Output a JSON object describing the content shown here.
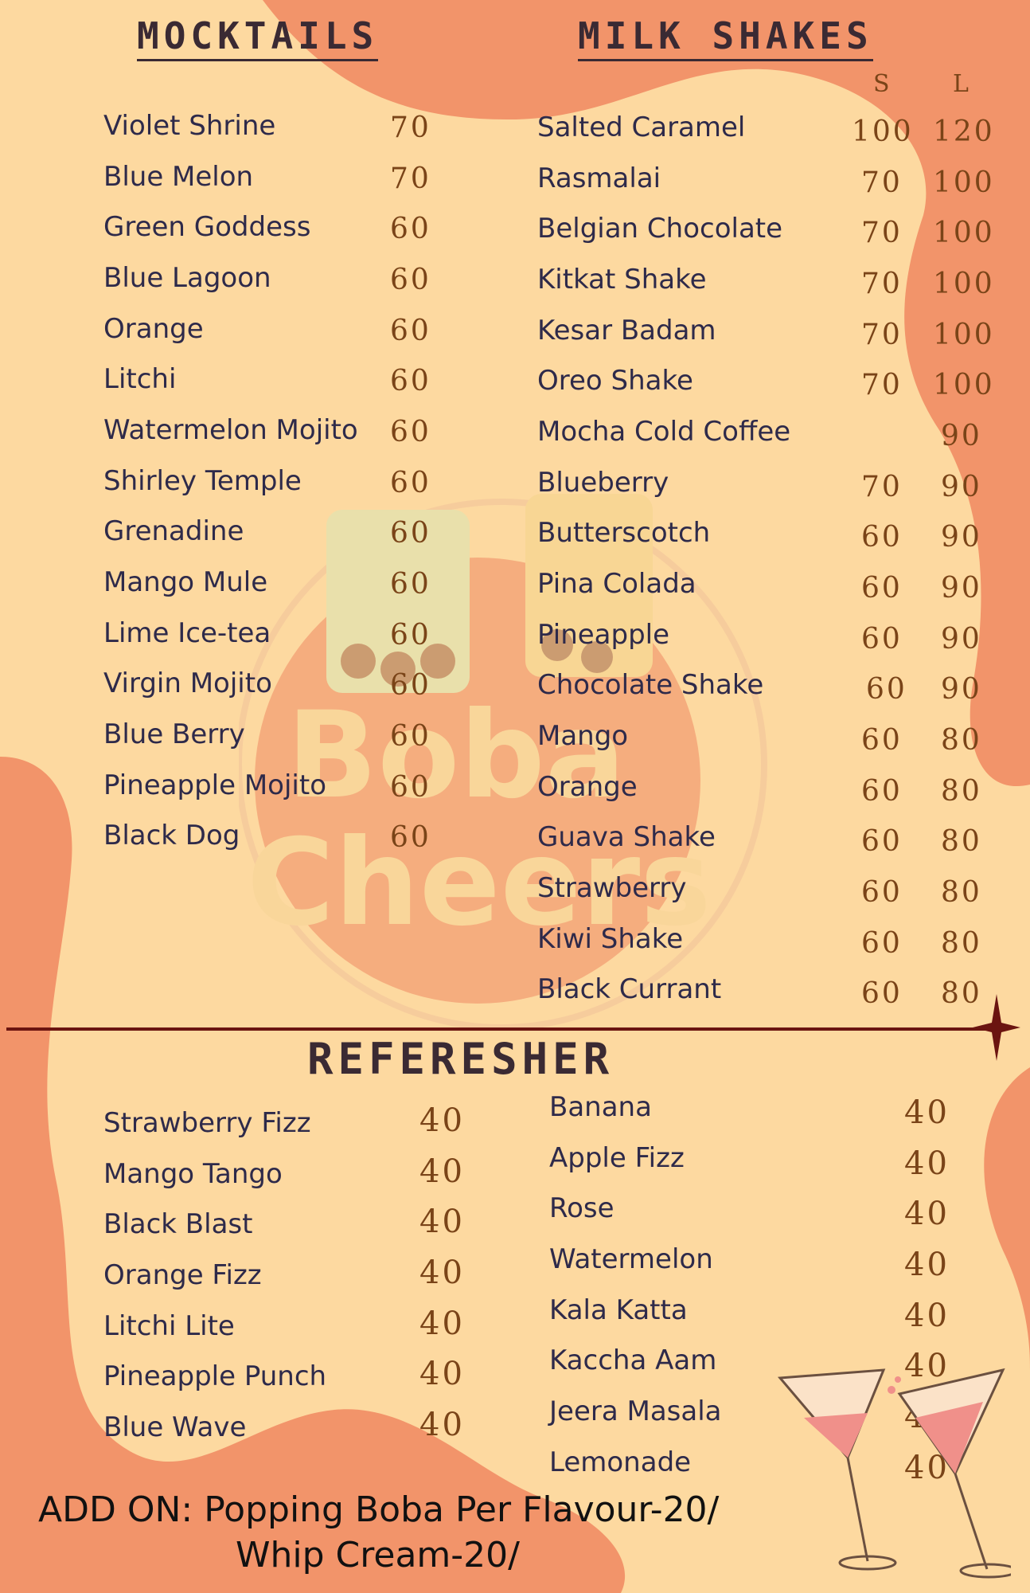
{
  "colors": {
    "background": "#fdd9a0",
    "accent_blob": "#f2946a",
    "heading": "#3a2a33",
    "item_text": "#2e2a4a",
    "price": "#7a4418",
    "divider": "#6b1410"
  },
  "mocktails": {
    "title": "MOCKTAILS",
    "items": [
      {
        "name": "Violet Shrine",
        "price": "70"
      },
      {
        "name": "Blue Melon",
        "price": "70"
      },
      {
        "name": "Green Goddess",
        "price": "60"
      },
      {
        "name": "Blue Lagoon",
        "price": "60"
      },
      {
        "name": "Orange",
        "price": "60"
      },
      {
        "name": "Litchi",
        "price": "60"
      },
      {
        "name": "Watermelon Mojito",
        "price": "60"
      },
      {
        "name": "Shirley Temple",
        "price": "60"
      },
      {
        "name": "Grenadine",
        "price": "60"
      },
      {
        "name": "Mango Mule",
        "price": "60"
      },
      {
        "name": "Lime Ice-tea",
        "price": "60"
      },
      {
        "name": "Virgin Mojito",
        "price": "60"
      },
      {
        "name": "Blue Berry",
        "price": "60"
      },
      {
        "name": "Pineapple Mojito",
        "price": "60"
      },
      {
        "name": "Black Dog",
        "price": "60"
      }
    ]
  },
  "milkshakes": {
    "title": "MILK SHAKES",
    "size_small": "S",
    "size_large": "L",
    "items": [
      {
        "name": "Salted Caramel",
        "small": "100",
        "large": "120"
      },
      {
        "name": "Rasmalai",
        "small": "70",
        "large": "100"
      },
      {
        "name": "Belgian Chocolate",
        "small": "70",
        "large": "100"
      },
      {
        "name": "Kitkat Shake",
        "small": "70",
        "large": "100"
      },
      {
        "name": "Kesar Badam",
        "small": "70",
        "large": "100"
      },
      {
        "name": "Oreo Shake",
        "small": "70",
        "large": "100"
      },
      {
        "name": "Mocha Cold Coffee",
        "small": "",
        "large": "90"
      },
      {
        "name": "Blueberry",
        "small": "70",
        "large": "90"
      },
      {
        "name": "Butterscotch",
        "small": "60",
        "large": "90"
      },
      {
        "name": "Pina Colada",
        "small": "60",
        "large": "90"
      },
      {
        "name": "Pineapple",
        "small": "60",
        "large": "90"
      },
      {
        "name": "Chocolate Shake",
        "small": "60",
        "large": "90"
      },
      {
        "name": "Mango",
        "small": "60",
        "large": "80"
      },
      {
        "name": "Orange",
        "small": "60",
        "large": "80"
      },
      {
        "name": "Guava Shake",
        "small": "60",
        "large": "80"
      },
      {
        "name": "Strawberry",
        "small": "60",
        "large": "80"
      },
      {
        "name": "Kiwi Shake",
        "small": "60",
        "large": "80"
      },
      {
        "name": "Black Currant",
        "small": "60",
        "large": "80"
      }
    ]
  },
  "refresher": {
    "title": "REFERESHER",
    "left_items": [
      {
        "name": "Strawberry Fizz",
        "price": "40"
      },
      {
        "name": "Mango Tango",
        "price": "40"
      },
      {
        "name": "Black Blast",
        "price": "40"
      },
      {
        "name": "Orange Fizz",
        "price": "40"
      },
      {
        "name": "Litchi Lite",
        "price": "40"
      },
      {
        "name": "Pineapple Punch",
        "price": "40"
      },
      {
        "name": "Blue Wave",
        "price": "40"
      }
    ],
    "right_items": [
      {
        "name": "Banana",
        "price": "40"
      },
      {
        "name": "Apple Fizz",
        "price": "40"
      },
      {
        "name": "Rose",
        "price": "40"
      },
      {
        "name": "Watermelon",
        "price": "40"
      },
      {
        "name": "Kala Katta",
        "price": "40"
      },
      {
        "name": "Kaccha Aam",
        "price": "40"
      },
      {
        "name": "Jeera Masala",
        "price": "40"
      },
      {
        "name": "Lemonade",
        "price": "40"
      }
    ]
  },
  "add_on": {
    "line1": "ADD ON: Popping Boba Per Flavour-20/",
    "line2": "Whip Cream-20/"
  },
  "watermark": {
    "line1": "Boba",
    "line2": "Cheers"
  }
}
